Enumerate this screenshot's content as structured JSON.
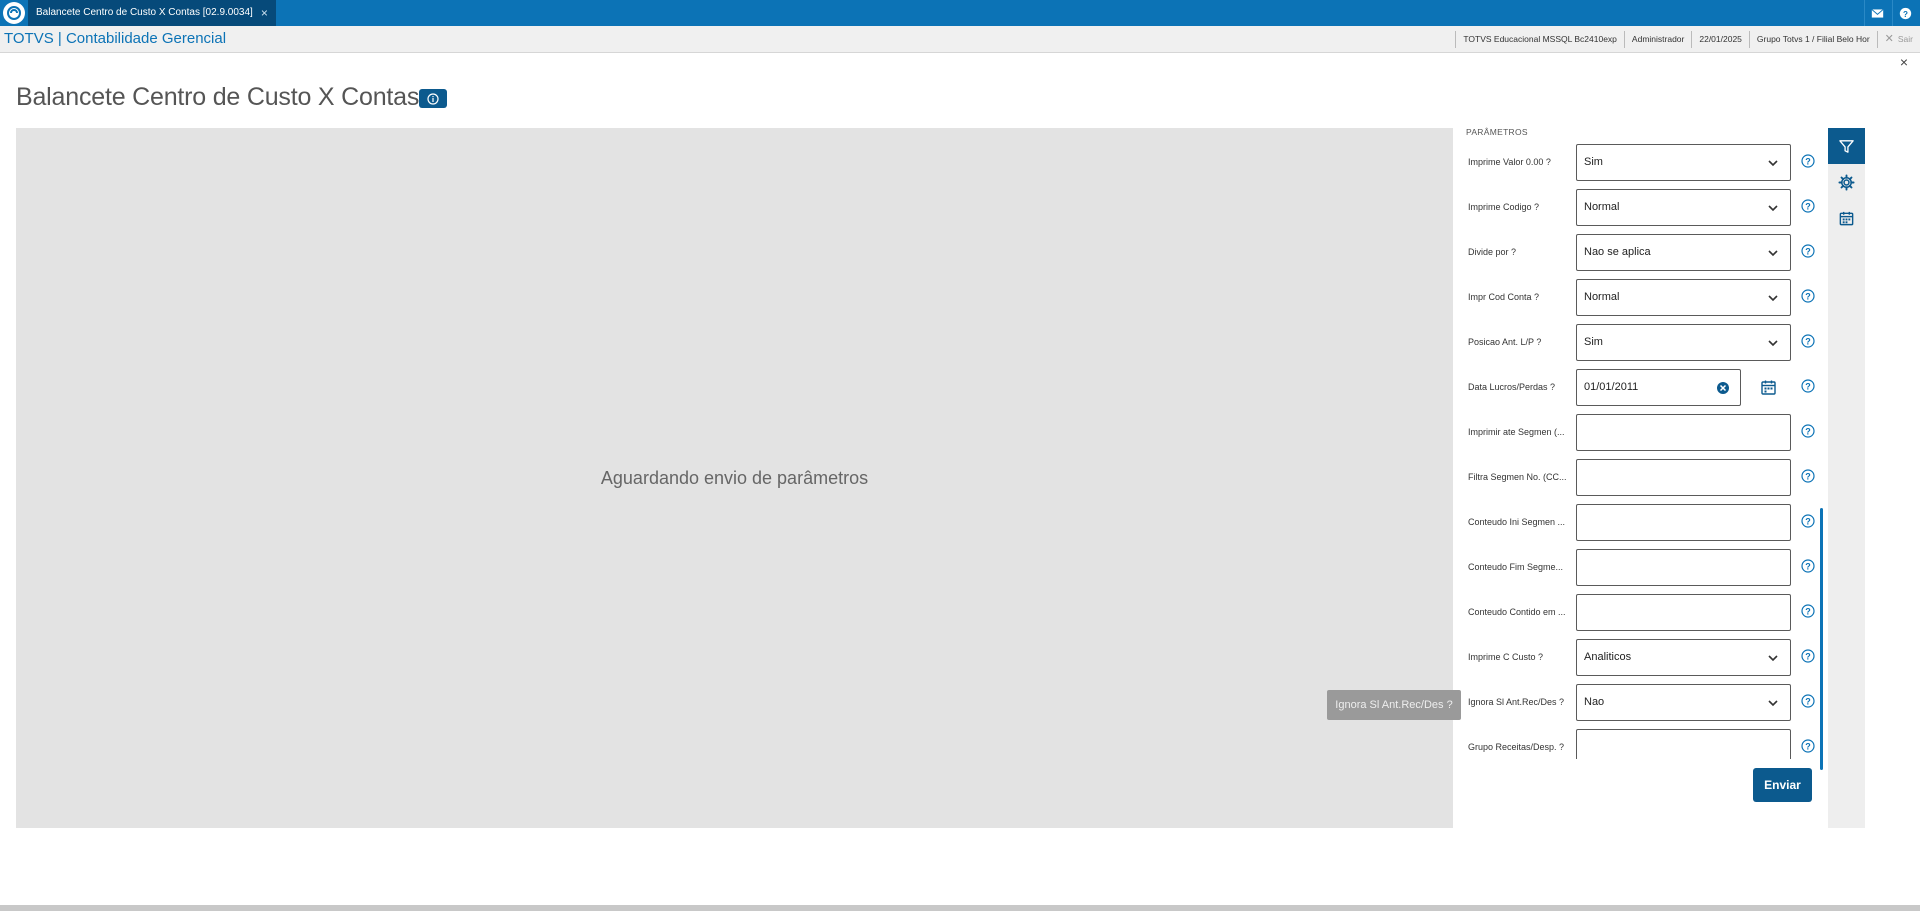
{
  "topbar": {
    "tab_label": "Balancete Centro de Custo X Contas [02.9.0034]",
    "tab_close": "×"
  },
  "subheader": {
    "brand": "TOTVS | Contabilidade Gerencial",
    "environment": "TOTVS Educacional MSSQL Bc2410exp",
    "user": "Administrador",
    "date": "22/01/2025",
    "branch": "Grupo Totvs 1 / Filial Belo Hor",
    "logout": "Sair"
  },
  "page": {
    "title": "Balancete Centro de Custo X Contas",
    "close": "×",
    "preview_message": "Aguardando envio de parâmetros"
  },
  "params": {
    "title": "PARÂMETROS",
    "rows": [
      {
        "label": "Imprime Valor 0.00 ?",
        "value": "Sim",
        "type": "select"
      },
      {
        "label": "Imprime Codigo ?",
        "value": "Normal",
        "type": "select"
      },
      {
        "label": "Divide por ?",
        "value": "Nao se aplica",
        "type": "select"
      },
      {
        "label": "Impr Cod Conta ?",
        "value": "Normal",
        "type": "select"
      },
      {
        "label": "Posicao Ant. L/P ?",
        "value": "Sim",
        "type": "select"
      },
      {
        "label": "Data Lucros/Perdas ?",
        "value": "01/01/2011",
        "type": "date"
      },
      {
        "label": "Imprimir ate Segmen (...",
        "value": "",
        "type": "text"
      },
      {
        "label": "Filtra Segmen No. (CC...",
        "value": "",
        "type": "text"
      },
      {
        "label": "Conteudo Ini Segmen ...",
        "value": "",
        "type": "text"
      },
      {
        "label": "Conteudo Fim Segme...",
        "value": "",
        "type": "text"
      },
      {
        "label": "Conteudo Contido em ...",
        "value": "",
        "type": "text"
      },
      {
        "label": "Imprime C Custo ?",
        "value": "Analiticos",
        "type": "select"
      },
      {
        "label": "Ignora Sl Ant.Rec/Des ?",
        "value": "Nao",
        "type": "select"
      },
      {
        "label": "Grupo Receitas/Desp. ?",
        "value": "",
        "type": "text"
      }
    ],
    "tooltip": "Ignora Sl Ant.Rec/Des ?",
    "send_label": "Enviar"
  },
  "toolbar": {
    "items": [
      "filter-icon",
      "gear-icon",
      "calendar-icon"
    ]
  },
  "colors": {
    "brand": "#0c73b6",
    "dark_brand": "#0c5a8e",
    "preview_bg": "#e3e3e3"
  }
}
